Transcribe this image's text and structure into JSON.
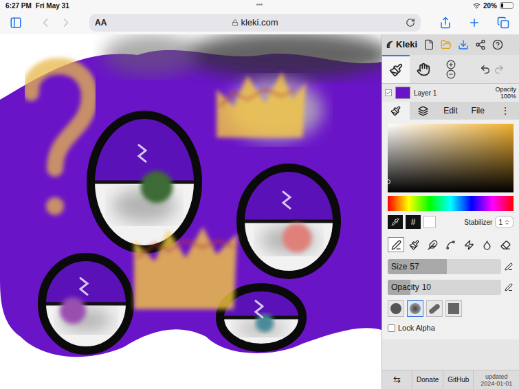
{
  "status_bar": {
    "time": "6:27 PM",
    "date": "Fri May 31",
    "dots": "•••",
    "battery": "20%",
    "battery_level": 0.2
  },
  "browser": {
    "back_enabled": false,
    "forward_enabled": false,
    "text_size_button": "AA",
    "url": "kleki.com"
  },
  "app": {
    "logo": "Kleki",
    "tools": [
      {
        "kind": "brush",
        "selected": true
      },
      {
        "kind": "hand",
        "selected": false
      }
    ],
    "undo_enabled": true,
    "redo_enabled": false,
    "layer": {
      "name": "Layer 1",
      "visible": true,
      "opacity_label": "Opacity",
      "opacity": "100%"
    },
    "tabs": [
      {
        "kind": "brush",
        "selected": true
      },
      {
        "kind": "layers",
        "selected": false
      },
      {
        "kind": "text",
        "label": "Edit",
        "selected": false
      },
      {
        "kind": "text",
        "label": "File",
        "selected": false
      },
      {
        "kind": "text",
        "label": "⋮",
        "selected": false
      }
    ],
    "color": {
      "hex_button": "#",
      "stabilizer_label": "Stabilizer",
      "stabilizer": "1"
    },
    "brushes": [
      {
        "kind": "pen",
        "selected": true
      },
      {
        "kind": "blend",
        "selected": false
      },
      {
        "kind": "sketch",
        "selected": false
      },
      {
        "kind": "curve",
        "selected": false
      },
      {
        "kind": "pixel",
        "selected": false
      },
      {
        "kind": "smudge",
        "selected": false
      },
      {
        "kind": "eraser",
        "selected": false
      }
    ],
    "sliders": [
      {
        "label": "Size",
        "value": "57",
        "level": 0.52
      },
      {
        "label": "Opacity",
        "value": "10",
        "level": 0.2
      }
    ],
    "shapes": [
      {
        "kind": "circle",
        "selected": false
      },
      {
        "kind": "soft",
        "selected": true
      },
      {
        "kind": "chalk",
        "selected": false
      },
      {
        "kind": "square",
        "selected": false
      }
    ],
    "lock_alpha": {
      "label": "Lock Alpha",
      "checked": false
    },
    "footer": {
      "swap": "⇆",
      "donate": "Donate",
      "github": "GitHub",
      "updated_label": "updated",
      "updated": "2024-01-01"
    }
  }
}
